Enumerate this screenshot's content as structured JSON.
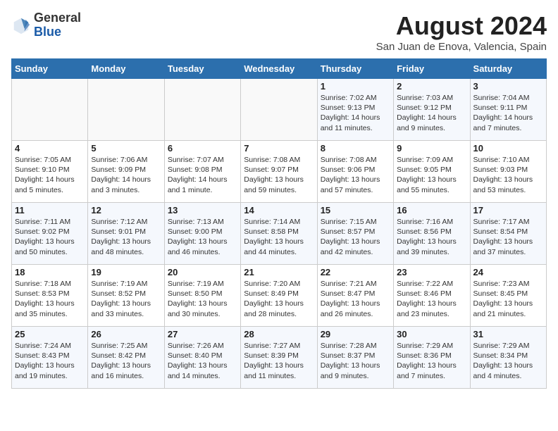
{
  "header": {
    "logo_general": "General",
    "logo_blue": "Blue",
    "month_year": "August 2024",
    "location": "San Juan de Enova, Valencia, Spain"
  },
  "days_of_week": [
    "Sunday",
    "Monday",
    "Tuesday",
    "Wednesday",
    "Thursday",
    "Friday",
    "Saturday"
  ],
  "weeks": [
    [
      {
        "day": "",
        "info": ""
      },
      {
        "day": "",
        "info": ""
      },
      {
        "day": "",
        "info": ""
      },
      {
        "day": "",
        "info": ""
      },
      {
        "day": "1",
        "info": "Sunrise: 7:02 AM\nSunset: 9:13 PM\nDaylight: 14 hours\nand 11 minutes."
      },
      {
        "day": "2",
        "info": "Sunrise: 7:03 AM\nSunset: 9:12 PM\nDaylight: 14 hours\nand 9 minutes."
      },
      {
        "day": "3",
        "info": "Sunrise: 7:04 AM\nSunset: 9:11 PM\nDaylight: 14 hours\nand 7 minutes."
      }
    ],
    [
      {
        "day": "4",
        "info": "Sunrise: 7:05 AM\nSunset: 9:10 PM\nDaylight: 14 hours\nand 5 minutes."
      },
      {
        "day": "5",
        "info": "Sunrise: 7:06 AM\nSunset: 9:09 PM\nDaylight: 14 hours\nand 3 minutes."
      },
      {
        "day": "6",
        "info": "Sunrise: 7:07 AM\nSunset: 9:08 PM\nDaylight: 14 hours\nand 1 minute."
      },
      {
        "day": "7",
        "info": "Sunrise: 7:08 AM\nSunset: 9:07 PM\nDaylight: 13 hours\nand 59 minutes."
      },
      {
        "day": "8",
        "info": "Sunrise: 7:08 AM\nSunset: 9:06 PM\nDaylight: 13 hours\nand 57 minutes."
      },
      {
        "day": "9",
        "info": "Sunrise: 7:09 AM\nSunset: 9:05 PM\nDaylight: 13 hours\nand 55 minutes."
      },
      {
        "day": "10",
        "info": "Sunrise: 7:10 AM\nSunset: 9:03 PM\nDaylight: 13 hours\nand 53 minutes."
      }
    ],
    [
      {
        "day": "11",
        "info": "Sunrise: 7:11 AM\nSunset: 9:02 PM\nDaylight: 13 hours\nand 50 minutes."
      },
      {
        "day": "12",
        "info": "Sunrise: 7:12 AM\nSunset: 9:01 PM\nDaylight: 13 hours\nand 48 minutes."
      },
      {
        "day": "13",
        "info": "Sunrise: 7:13 AM\nSunset: 9:00 PM\nDaylight: 13 hours\nand 46 minutes."
      },
      {
        "day": "14",
        "info": "Sunrise: 7:14 AM\nSunset: 8:58 PM\nDaylight: 13 hours\nand 44 minutes."
      },
      {
        "day": "15",
        "info": "Sunrise: 7:15 AM\nSunset: 8:57 PM\nDaylight: 13 hours\nand 42 minutes."
      },
      {
        "day": "16",
        "info": "Sunrise: 7:16 AM\nSunset: 8:56 PM\nDaylight: 13 hours\nand 39 minutes."
      },
      {
        "day": "17",
        "info": "Sunrise: 7:17 AM\nSunset: 8:54 PM\nDaylight: 13 hours\nand 37 minutes."
      }
    ],
    [
      {
        "day": "18",
        "info": "Sunrise: 7:18 AM\nSunset: 8:53 PM\nDaylight: 13 hours\nand 35 minutes."
      },
      {
        "day": "19",
        "info": "Sunrise: 7:19 AM\nSunset: 8:52 PM\nDaylight: 13 hours\nand 33 minutes."
      },
      {
        "day": "20",
        "info": "Sunrise: 7:19 AM\nSunset: 8:50 PM\nDaylight: 13 hours\nand 30 minutes."
      },
      {
        "day": "21",
        "info": "Sunrise: 7:20 AM\nSunset: 8:49 PM\nDaylight: 13 hours\nand 28 minutes."
      },
      {
        "day": "22",
        "info": "Sunrise: 7:21 AM\nSunset: 8:47 PM\nDaylight: 13 hours\nand 26 minutes."
      },
      {
        "day": "23",
        "info": "Sunrise: 7:22 AM\nSunset: 8:46 PM\nDaylight: 13 hours\nand 23 minutes."
      },
      {
        "day": "24",
        "info": "Sunrise: 7:23 AM\nSunset: 8:45 PM\nDaylight: 13 hours\nand 21 minutes."
      }
    ],
    [
      {
        "day": "25",
        "info": "Sunrise: 7:24 AM\nSunset: 8:43 PM\nDaylight: 13 hours\nand 19 minutes."
      },
      {
        "day": "26",
        "info": "Sunrise: 7:25 AM\nSunset: 8:42 PM\nDaylight: 13 hours\nand 16 minutes."
      },
      {
        "day": "27",
        "info": "Sunrise: 7:26 AM\nSunset: 8:40 PM\nDaylight: 13 hours\nand 14 minutes."
      },
      {
        "day": "28",
        "info": "Sunrise: 7:27 AM\nSunset: 8:39 PM\nDaylight: 13 hours\nand 11 minutes."
      },
      {
        "day": "29",
        "info": "Sunrise: 7:28 AM\nSunset: 8:37 PM\nDaylight: 13 hours\nand 9 minutes."
      },
      {
        "day": "30",
        "info": "Sunrise: 7:29 AM\nSunset: 8:36 PM\nDaylight: 13 hours\nand 7 minutes."
      },
      {
        "day": "31",
        "info": "Sunrise: 7:29 AM\nSunset: 8:34 PM\nDaylight: 13 hours\nand 4 minutes."
      }
    ]
  ]
}
